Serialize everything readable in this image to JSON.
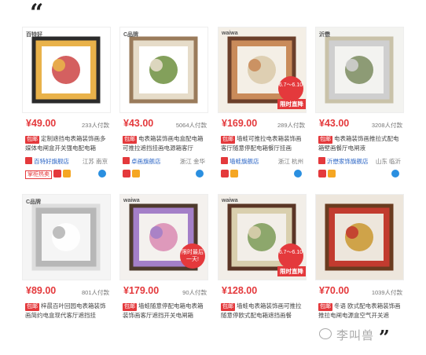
{
  "quote_open": "“",
  "quote_close": "”",
  "watermark": "李叫兽",
  "products": [
    {
      "brand": "百特好",
      "price": "¥49.00",
      "sold": "233人付款",
      "tag": "包邮",
      "desc": "定制遮挡电表箱装饰画多媒体电闸盒开关强电配电箱",
      "shop": "百特好旗舰店",
      "location": "江苏 南京",
      "badge": "掌柜热卖",
      "colors": [
        "#ffffff",
        "#2b2b2b",
        "#c44",
        "#e9b24a"
      ]
    },
    {
      "brand": "C品牌",
      "price": "¥43.00",
      "sold": "5064人付款",
      "tag": "包邮",
      "desc": "电表箱装饰画电盒配电箱可推拉遮挡挂画电源箱客厅",
      "shop": "卓画旗舰店",
      "location": "浙江 金华",
      "badge": "",
      "colors": [
        "#ffffff",
        "#9a7b5b",
        "#6d8f3e",
        "#e6dcc9"
      ]
    },
    {
      "brand": "waiwa",
      "price": "¥169.00",
      "sold": "289人付款",
      "tag": "包邮",
      "desc": "墙蛙可推拉电表箱装饰画客厅随意停配电箱餐厅挂画",
      "shop": "墙蛙旗舰店",
      "location": "浙江 杭州",
      "badge": "",
      "promo": "6.7～6.10",
      "buy": "限时直降",
      "colors": [
        "#f4efe6",
        "#6b3f2a",
        "#d9c9a8",
        "#c98b5a"
      ]
    },
    {
      "brand": "沂懋",
      "price": "¥43.00",
      "sold": "3208人付款",
      "tag": "包邮",
      "desc": "电表箱装饰画推拉式配电箱壁画餐厅电闸液",
      "shop": "沂懋家饰旗舰店",
      "location": "山东 临沂",
      "badge": "",
      "colors": [
        "#f3f3f0",
        "#c9c2a9",
        "#7a8b5f",
        "#cfcfcf"
      ]
    },
    {
      "brand": "C品牌",
      "price": "¥89.00",
      "sold": "801人付款",
      "tag": "包邮",
      "desc": "梓晨百叶回园电表箱装饰画简约电盒现代客厅遮挡挂",
      "shop": "",
      "location": "",
      "badge": "",
      "colors": [
        "#f5f5f5",
        "#dddddd",
        "#ffffff",
        "#b7b7b7"
      ]
    },
    {
      "brand": "waiwa",
      "price": "¥179.00",
      "sold": "90人付款",
      "tag": "包邮",
      "desc": "墙蛙随意停配电箱电表箱装饰画客厅遮挡开关电闸箱",
      "shop": "",
      "location": "",
      "badge": "",
      "promo": "限时最后一天!",
      "colors": [
        "#f4f1ee",
        "#4e3a2d",
        "#d98ab1",
        "#a47fc8"
      ]
    },
    {
      "brand": "waiwa",
      "price": "¥128.00",
      "sold": "",
      "tag": "包邮",
      "desc": "墙蛙电表箱装饰画可推拉随意停欧式配电箱遮挡画餐",
      "shop": "",
      "location": "",
      "badge": "",
      "promo": "6.7～6.10",
      "buy": "限时直降",
      "colors": [
        "#f2eee8",
        "#5a3526",
        "#7b9a56",
        "#d9cfae"
      ]
    },
    {
      "brand": "",
      "price": "¥70.00",
      "sold": "1039人付款",
      "tag": "包邮",
      "desc": "冬语 欧式配电表箱装饰画推拉电闸电源盒空气开关遮",
      "shop": "",
      "location": "",
      "badge": "",
      "colors": [
        "#ede6dc",
        "#6a3b1f",
        "#c9962f",
        "#c23b2f"
      ]
    }
  ]
}
